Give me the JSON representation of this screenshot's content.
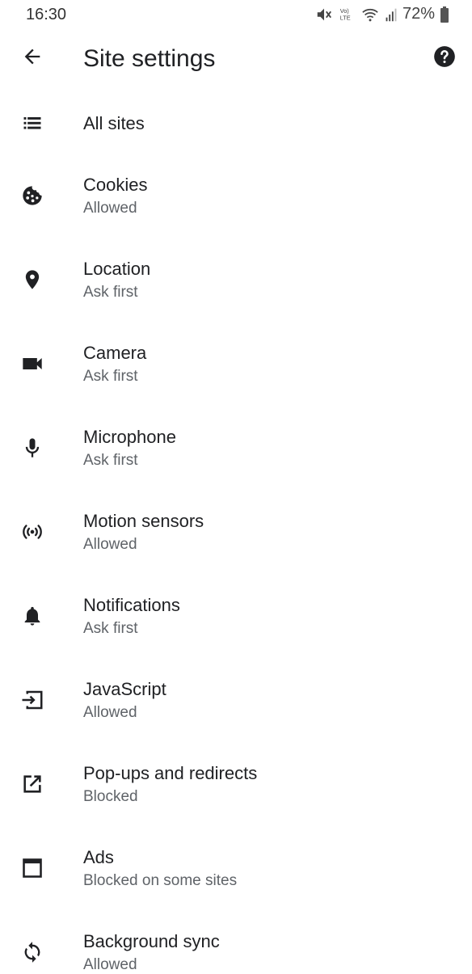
{
  "status_bar": {
    "time": "16:30",
    "network_label": "VoLTE",
    "battery": "72%",
    "icons": [
      "mute-icon",
      "volte-icon",
      "wifi-icon",
      "signal-icon",
      "battery-icon"
    ]
  },
  "header": {
    "title": "Site settings",
    "back_icon": "arrow-back-icon",
    "help_icon": "help-icon"
  },
  "items": [
    {
      "icon": "list-icon",
      "title": "All sites",
      "subtitle": ""
    },
    {
      "icon": "cookie-icon",
      "title": "Cookies",
      "subtitle": "Allowed"
    },
    {
      "icon": "location-pin-icon",
      "title": "Location",
      "subtitle": "Ask first"
    },
    {
      "icon": "videocam-icon",
      "title": "Camera",
      "subtitle": "Ask first"
    },
    {
      "icon": "mic-icon",
      "title": "Microphone",
      "subtitle": "Ask first"
    },
    {
      "icon": "motion-sensor-icon",
      "title": "Motion sensors",
      "subtitle": "Allowed"
    },
    {
      "icon": "bell-icon",
      "title": "Notifications",
      "subtitle": "Ask first"
    },
    {
      "icon": "input-arrow-icon",
      "title": "JavaScript",
      "subtitle": "Allowed"
    },
    {
      "icon": "open-in-new-icon",
      "title": "Pop-ups and redirects",
      "subtitle": "Blocked"
    },
    {
      "icon": "web-window-icon",
      "title": "Ads",
      "subtitle": "Blocked on some sites"
    },
    {
      "icon": "sync-icon",
      "title": "Background sync",
      "subtitle": "Allowed"
    }
  ]
}
